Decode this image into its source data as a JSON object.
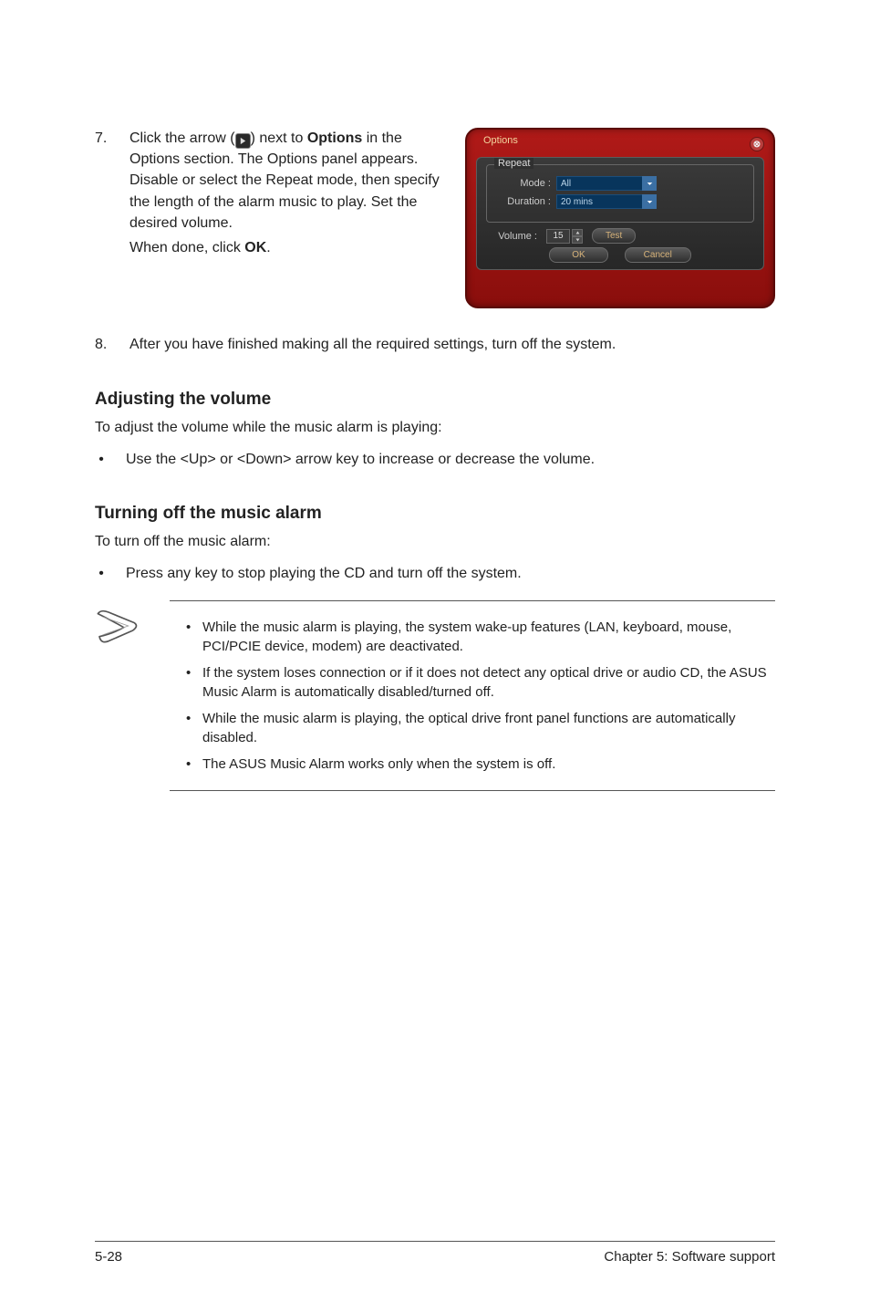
{
  "step7": {
    "num": "7.",
    "text_part1": "Click the arrow (",
    "text_part2": ") next to ",
    "options_bold": "Options",
    "text_part3": " in the Options section. The Options panel appears. Disable or select the Repeat mode, then specify the length of the alarm music to play. Set the desired volume.",
    "done_prefix": "When done, click ",
    "ok_bold": "OK",
    "done_suffix": "."
  },
  "panel": {
    "title": "Options",
    "repeat_legend": "Repeat",
    "mode_label": "Mode :",
    "mode_value": "All",
    "duration_label": "Duration :",
    "duration_value": "20 mins",
    "volume_label": "Volume :",
    "volume_value": "15",
    "test_btn": "Test",
    "ok_btn": "OK",
    "cancel_btn": "Cancel"
  },
  "step8": {
    "num": "8.",
    "text": "After you have finished making all the required settings, turn off the system."
  },
  "adjust": {
    "heading": "Adjusting the volume",
    "lead": "To adjust the volume while the music alarm is playing:",
    "bullet": "Use the  <Up> or <Down> arrow key to increase or decrease the volume."
  },
  "turnoff": {
    "heading": "Turning off the music alarm",
    "lead": "To turn off the music alarm:",
    "bullet": "Press any key to stop playing the CD and turn off the system."
  },
  "notes": [
    "While the music alarm is playing, the system wake-up features (LAN, keyboard, mouse, PCI/PCIE device, modem) are deactivated.",
    "If the system loses connection or if it does not detect any optical drive or audio CD, the ASUS Music Alarm is automatically disabled/turned off.",
    "While the music alarm is playing, the optical drive front panel functions are automatically disabled.",
    "The ASUS Music Alarm works only when the system is off."
  ],
  "footer": {
    "left": "5-28",
    "right": "Chapter 5: Software support"
  }
}
